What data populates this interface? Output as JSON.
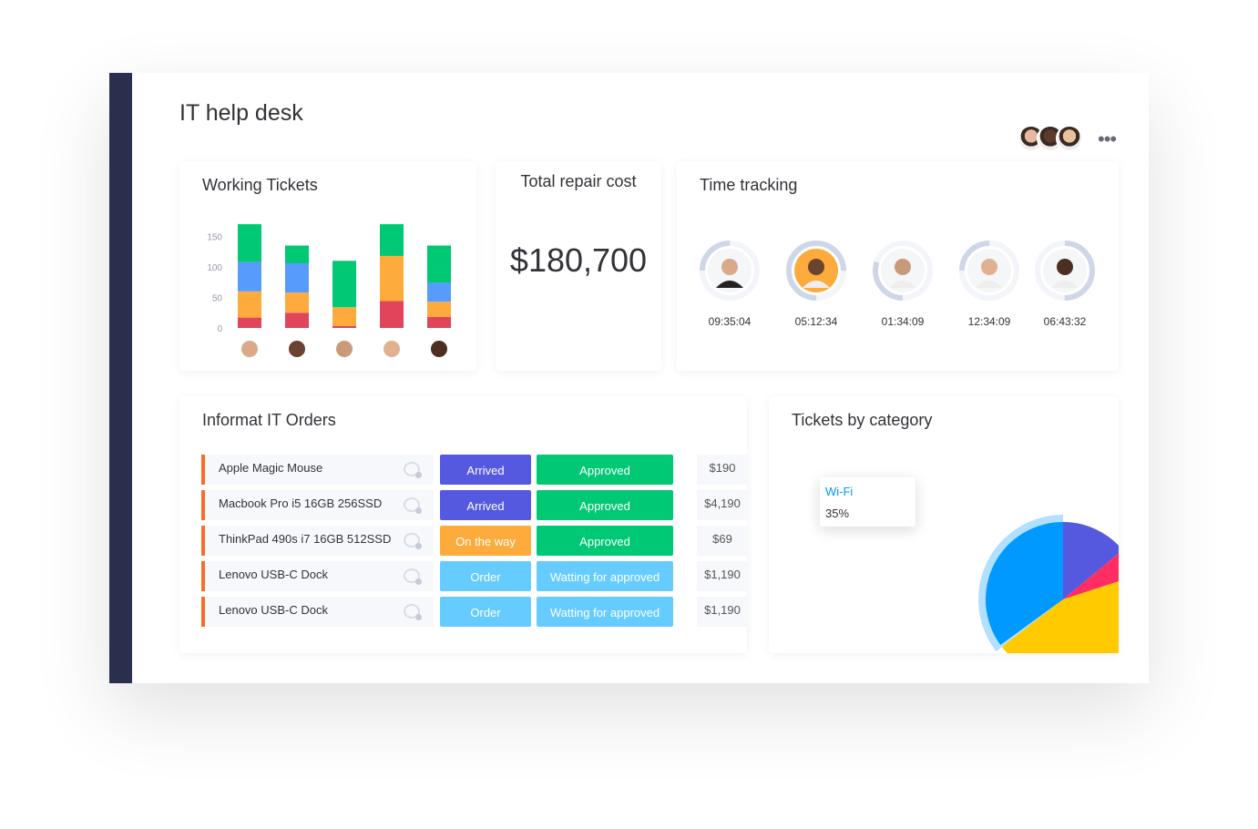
{
  "header": {
    "title": "IT help desk",
    "more_icon": "more-dots-icon",
    "team_avatars": [
      "#e6b8a2",
      "#5a3b2e",
      "#e8c29b"
    ]
  },
  "working_tickets": {
    "title": "Working Tickets",
    "chart_data": {
      "type": "bar",
      "stacked": true,
      "categories": [
        "user-1",
        "user-2",
        "user-3",
        "user-4",
        "user-5"
      ],
      "yticks": [
        0,
        50,
        100,
        150
      ],
      "ylim": [
        0,
        175
      ],
      "colors": {
        "red": "#e2445c",
        "orange": "#fdab3d",
        "blue": "#579bfc",
        "green": "#00c875"
      },
      "series": [
        {
          "color": "red",
          "values": [
            17,
            25,
            3,
            44,
            18
          ]
        },
        {
          "color": "orange",
          "values": [
            43,
            33,
            31,
            74,
            25
          ]
        },
        {
          "color": "blue",
          "values": [
            48,
            48,
            0,
            0,
            31
          ]
        },
        {
          "color": "green",
          "values": [
            62,
            29,
            76,
            52,
            61
          ]
        }
      ]
    }
  },
  "repair": {
    "title": "Total repair cost",
    "value": "$180,700"
  },
  "time_tracking": {
    "title": "Time tracking",
    "people": [
      {
        "time": "09:35:04",
        "progress": 0.25,
        "start": 270
      },
      {
        "time": "05:12:34",
        "progress": 0.75,
        "start": 180
      },
      {
        "time": "01:34:09",
        "progress": 0.3,
        "start": 180
      },
      {
        "time": "12:34:09",
        "progress": 0.25,
        "start": 270
      },
      {
        "time": "06:43:32",
        "progress": 0.5,
        "start": 0
      }
    ]
  },
  "orders": {
    "title": "Informat IT Orders",
    "rows": [
      {
        "item": "Apple Magic Mouse",
        "status": "Arrived",
        "status_color": "#5559df",
        "approval": "Approved",
        "approval_color": "#00c875",
        "price": "$190"
      },
      {
        "item": "Macbook Pro i5 16GB 256SSD",
        "status": "Arrived",
        "status_color": "#5559df",
        "approval": "Approved",
        "approval_color": "#00c875",
        "price": "$4,190"
      },
      {
        "item": "ThinkPad 490s  i7 16GB 512SSD",
        "status": "On the way",
        "status_color": "#fdab3d",
        "approval": "Approved",
        "approval_color": "#00c875",
        "price": "$69"
      },
      {
        "item": "Lenovo USB-C Dock",
        "status": "Order",
        "status_color": "#66ccff",
        "approval": "Watting for approved",
        "approval_color": "#66ccff",
        "price": "$1,190"
      },
      {
        "item": "Lenovo USB-C Dock",
        "status": "Order",
        "status_color": "#66ccff",
        "approval": "Watting for approved",
        "approval_color": "#66ccff",
        "price": "$1,190"
      }
    ]
  },
  "category": {
    "title": "Tickets by category",
    "tooltip": {
      "label": "Wi-Fi",
      "value": "35%"
    },
    "chart_data": {
      "type": "pie",
      "slices": [
        {
          "value": 14,
          "color": "#5559df"
        },
        {
          "value": 6,
          "color": "#ff2d62"
        },
        {
          "value": 45,
          "color": "#ffcb00"
        },
        {
          "name": "Wi-Fi",
          "value": 35,
          "color": "#0099ff",
          "highlighted": true
        }
      ]
    }
  }
}
